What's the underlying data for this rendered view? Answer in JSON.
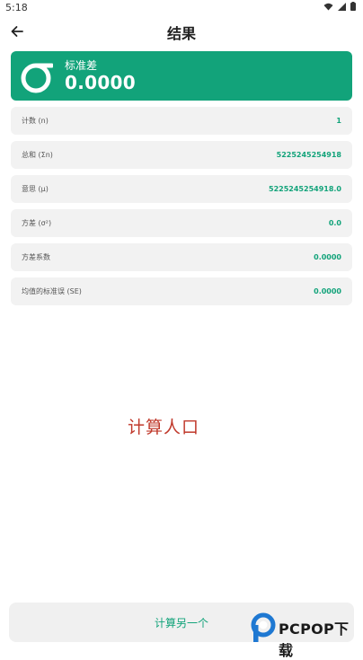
{
  "status_bar": {
    "time": "5:18"
  },
  "app_bar": {
    "title": "结果"
  },
  "summary": {
    "label": "标准差",
    "value": "0.0000"
  },
  "results": [
    {
      "label": "计数 (n)",
      "value": "1",
      "color": "#12a37a"
    },
    {
      "label": "总和 (Σn)",
      "value": "5225245254918",
      "color": "#12a37a"
    },
    {
      "label": "意思 (μ)",
      "value": "5225245254918.0",
      "color": "#12a37a"
    },
    {
      "label": "方差 (σ²)",
      "value": "0.0",
      "color": "#12a37a"
    },
    {
      "label": "方差系数",
      "value": "0.0000",
      "color": "#12a37a"
    },
    {
      "label": "均值的标准误 (SE)",
      "value": "0.0000",
      "color": "#12a37a"
    }
  ],
  "watermark_text": "计算人口",
  "calc_button": {
    "label": "计算另一个"
  },
  "brand": {
    "name": "PCPOP下载"
  },
  "colors": {
    "accent": "#12a37a",
    "watermark": "#c0392b",
    "row_bg": "#f2f2f2"
  }
}
